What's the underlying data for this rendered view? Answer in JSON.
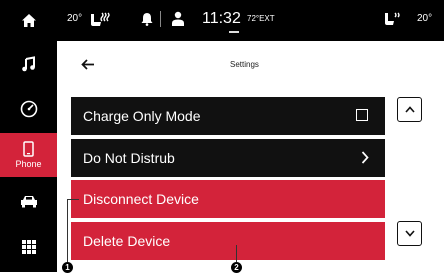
{
  "status": {
    "temp_left": "20°",
    "time": "11:32",
    "ext_temp": "72°EXT",
    "temp_right": "20°"
  },
  "sidebar": {
    "items": [
      {
        "icon": "home-icon"
      },
      {
        "icon": "music-icon"
      },
      {
        "icon": "gauge-icon"
      },
      {
        "icon": "phone-icon",
        "label": "Phone",
        "active": true
      },
      {
        "icon": "car-icon"
      },
      {
        "icon": "apps-grid-icon"
      }
    ]
  },
  "header": {
    "title": "Settings"
  },
  "settings_list": [
    {
      "label": "Charge Only Mode",
      "control": "checkbox"
    },
    {
      "label": "Do Not Distrub",
      "control": "chevron"
    },
    {
      "label": "Disconnect Device"
    },
    {
      "label": "Delete Device"
    }
  ],
  "callouts": [
    "1",
    "2"
  ],
  "colors": {
    "accent_red": "#d3233a",
    "row_dark": "#111111",
    "bar_black": "#000000"
  }
}
